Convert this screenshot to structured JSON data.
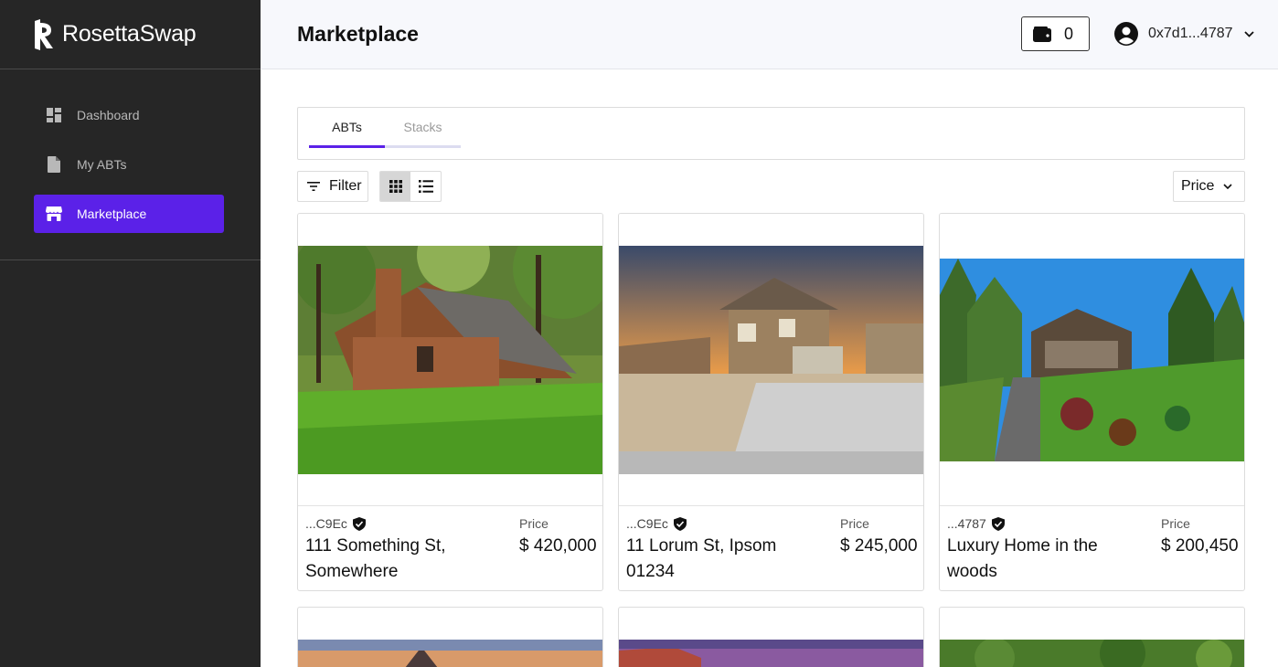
{
  "brand": {
    "name": "RosettaSwap"
  },
  "sidebar": {
    "items": [
      {
        "label": "Dashboard",
        "icon": "dashboard-icon"
      },
      {
        "label": "My ABTs",
        "icon": "document-icon"
      },
      {
        "label": "Marketplace",
        "icon": "store-icon",
        "active": true
      }
    ]
  },
  "header": {
    "title": "Marketplace",
    "wallet_count": "0",
    "account_address": "0x7d1...4787"
  },
  "tabs": [
    {
      "label": "ABTs",
      "active": true
    },
    {
      "label": "Stacks",
      "active": false
    }
  ],
  "toolbar": {
    "filter_label": "Filter",
    "sort_label": "Price"
  },
  "listings": [
    {
      "owner": "...C9Ec",
      "verified": true,
      "address": "111 Something St, Somewhere",
      "price_label": "Price",
      "price": "$ 420,000"
    },
    {
      "owner": "...C9Ec",
      "verified": true,
      "address": "11 Lorum St, Ipsom 01234",
      "price_label": "Price",
      "price": "$ 245,000"
    },
    {
      "owner": "...4787",
      "verified": true,
      "address": "Luxury Home in the woods",
      "price_label": "Price",
      "price": "$ 200,450"
    }
  ],
  "colors": {
    "accent": "#5b21e8",
    "sidebar_bg": "#262626",
    "header_bg": "#f7f8fc"
  }
}
